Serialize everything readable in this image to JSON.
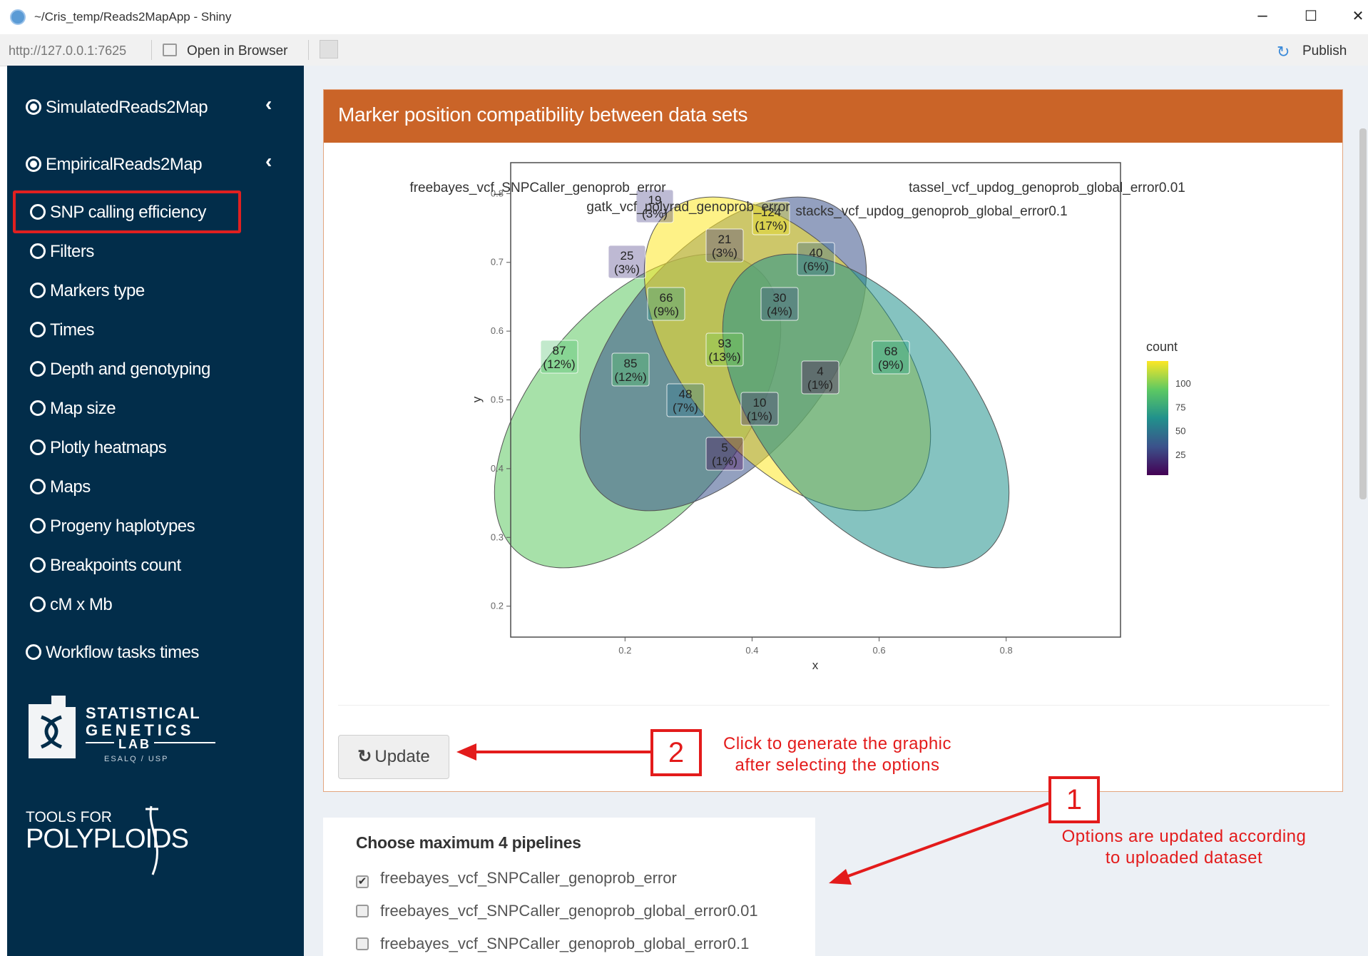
{
  "window": {
    "title": "~/Cris_temp/Reads2MapApp - Shiny",
    "minimize": "–",
    "maximize": "☐",
    "close": "✕"
  },
  "toolbar": {
    "url": "http://127.0.0.1:7625",
    "open_in_browser": "Open in Browser",
    "publish": "Publish"
  },
  "sidebar": {
    "sections": [
      {
        "label": "SimulatedReads2Map",
        "chevron": "‹"
      },
      {
        "label": "EmpiricalReads2Map",
        "chevron": "‹"
      }
    ],
    "items": [
      {
        "label": "SNP calling efficiency"
      },
      {
        "label": "Filters"
      },
      {
        "label": "Markers type"
      },
      {
        "label": "Times"
      },
      {
        "label": "Depth and genotyping"
      },
      {
        "label": "Map size"
      },
      {
        "label": "Plotly heatmaps"
      },
      {
        "label": "Maps"
      },
      {
        "label": "Progeny haplotypes"
      },
      {
        "label": "Breakpoints count"
      },
      {
        "label": "cM x Mb"
      }
    ],
    "workflow": "Workflow tasks times",
    "logo1": {
      "line1": "STATISTICAL",
      "line2": "GENETICS",
      "line3": "LAB",
      "line4": "ESALQ / USP"
    },
    "logo2": {
      "line1": "TOOLS FOR",
      "line2": "POLYPLOIDS"
    }
  },
  "main": {
    "box_title": "Marker position compatibility between data sets",
    "update_label": "Update",
    "update_icon": "↻"
  },
  "chart_data": {
    "type": "venn",
    "sets": [
      "freebayes_vcf_SNPCaller_genoprob_error",
      "gatk_vcf_polyrad_genoprob_error",
      "stacks_vcf_updog_genoprob_global_error0.1",
      "tassel_vcf_updog_genoprob_global_error0.01"
    ],
    "regions": [
      {
        "count": "87",
        "pct": "(12%)",
        "color": "#4fbf6e"
      },
      {
        "count": "19",
        "pct": "(3%)",
        "color": "#433d85"
      },
      {
        "count": "124",
        "pct": "(17%)",
        "color": "#f1e51d"
      },
      {
        "count": "68",
        "pct": "(9%)",
        "color": "#22a485"
      },
      {
        "count": "25",
        "pct": "(3%)",
        "color": "#453681"
      },
      {
        "count": "21",
        "pct": "(3%)",
        "color": "#443a83"
      },
      {
        "count": "40",
        "pct": "(6%)",
        "color": "#31688e"
      },
      {
        "count": "66",
        "pct": "(9%)",
        "color": "#2a9b8a"
      },
      {
        "count": "30",
        "pct": "(4%)",
        "color": "#3d4c8a"
      },
      {
        "count": "93",
        "pct": "(13%)",
        "color": "#7ad151"
      },
      {
        "count": "85",
        "pct": "(12%)",
        "color": "#54c568"
      },
      {
        "count": "4",
        "pct": "(1%)",
        "color": "#440154"
      },
      {
        "count": "48",
        "pct": "(7%)",
        "color": "#2c728e"
      },
      {
        "count": "10",
        "pct": "(1%)",
        "color": "#472d7b"
      },
      {
        "count": "5",
        "pct": "(1%)",
        "color": "#440154"
      }
    ],
    "x_axis": {
      "label": "x",
      "ticks": [
        "0.2",
        "0.4",
        "0.6",
        "0.8"
      ],
      "range": [
        0.02,
        0.98
      ]
    },
    "y_axis": {
      "label": "y",
      "ticks": [
        "0.2",
        "0.3",
        "0.4",
        "0.5",
        "0.6",
        "0.7",
        "0.8"
      ],
      "range": [
        0.155,
        0.845
      ]
    },
    "legend": {
      "title": "count",
      "ticks": [
        "100",
        "75",
        "50",
        "25"
      ],
      "range": [
        4,
        124
      ],
      "position": "right"
    },
    "colorscale": [
      "#440154",
      "#3b528b",
      "#21918c",
      "#5ec962",
      "#fde725"
    ]
  },
  "annotations": {
    "badge2": "2",
    "text2_line1": "Click to generate the graphic",
    "text2_line2": "after selecting the options",
    "badge1": "1",
    "text1_line1": "Options are updated according",
    "text1_line2": "to uploaded dataset",
    "color": "#e31b1b"
  },
  "options": {
    "title": "Choose maximum 4 pipelines",
    "items": [
      {
        "label": "freebayes_vcf_SNPCaller_genoprob_error",
        "checked": true
      },
      {
        "label": "freebayes_vcf_SNPCaller_genoprob_global_error0.01",
        "checked": false
      },
      {
        "label": "freebayes_vcf_SNPCaller_genoprob_global_error0.1",
        "checked": false
      }
    ]
  }
}
